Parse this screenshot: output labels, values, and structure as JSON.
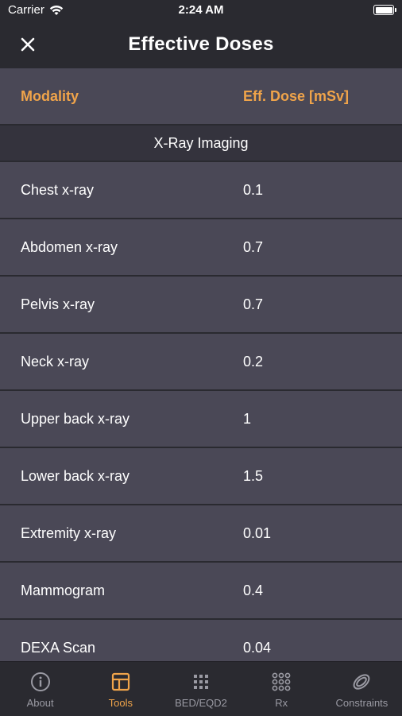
{
  "status_bar": {
    "carrier": "Carrier",
    "time": "2:24 AM"
  },
  "nav": {
    "title": "Effective Doses",
    "close_icon": "close-icon"
  },
  "table": {
    "header": {
      "modality": "Modality",
      "dose": "Eff. Dose [mSv]"
    },
    "section": "X-Ray Imaging",
    "rows": [
      {
        "modality": "Chest x-ray",
        "dose": "0.1"
      },
      {
        "modality": "Abdomen x-ray",
        "dose": "0.7"
      },
      {
        "modality": "Pelvis x-ray",
        "dose": "0.7"
      },
      {
        "modality": "Neck x-ray",
        "dose": "0.2"
      },
      {
        "modality": "Upper back x-ray",
        "dose": "1"
      },
      {
        "modality": "Lower back x-ray",
        "dose": "1.5"
      },
      {
        "modality": "Extremity x-ray",
        "dose": "0.01"
      },
      {
        "modality": "Mammogram",
        "dose": "0.4"
      },
      {
        "modality": "DEXA Scan",
        "dose": "0.04"
      }
    ]
  },
  "tabs": [
    {
      "label": "About",
      "icon": "info-icon",
      "active": false
    },
    {
      "label": "Tools",
      "icon": "tools-icon",
      "active": true
    },
    {
      "label": "BED/EQD2",
      "icon": "grid-icon",
      "active": false
    },
    {
      "label": "Rx",
      "icon": "dots-grid-icon",
      "active": false
    },
    {
      "label": "Constraints",
      "icon": "rings-icon",
      "active": false
    }
  ],
  "colors": {
    "accent": "#f0a44a",
    "bar_bg": "#2a2a30",
    "row_bg": "#4a4856",
    "section_bg": "#34333d",
    "inactive_tab": "#9a9aa3"
  }
}
